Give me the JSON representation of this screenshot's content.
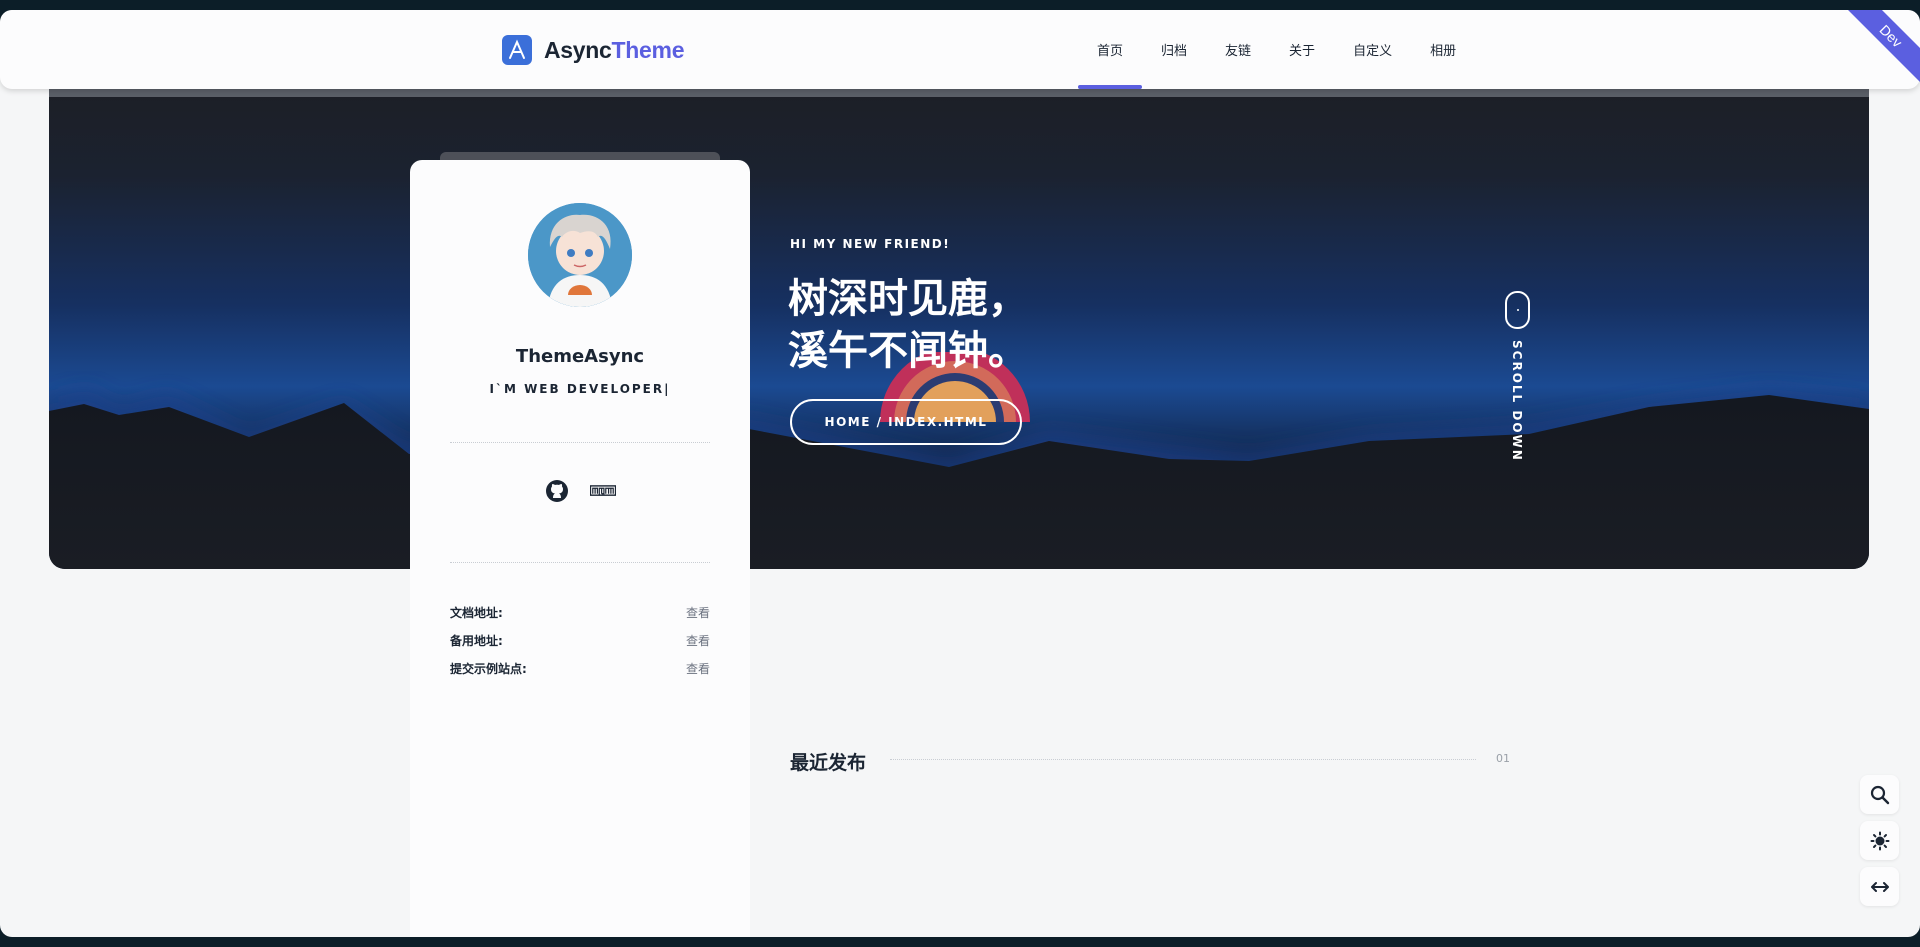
{
  "header": {
    "logo_text_a": "Async",
    "logo_text_b": "Theme",
    "nav": [
      "首页",
      "归档",
      "友链",
      "关于",
      "自定义",
      "相册"
    ],
    "active_index": 0,
    "badge": "Dev"
  },
  "profile": {
    "name": "ThemeAsync",
    "subtitle": "I`M WEB DEVELOPER|",
    "links": [
      {
        "label": "文档地址:",
        "action": "查看"
      },
      {
        "label": "备用地址:",
        "action": "查看"
      },
      {
        "label": "提交示例站点:",
        "action": "查看"
      }
    ]
  },
  "hero": {
    "kicker": "HI MY NEW FRIEND!",
    "title_line1": "树深时见鹿，",
    "title_line2": "溪午不闻钟。",
    "button": "HOME / INDEX.HTML",
    "scroll": "SCROLL DOWN"
  },
  "recent": {
    "title": "最近发布",
    "number": "01"
  },
  "colors": {
    "accent": "#5b5fe0",
    "text": "#1b2533",
    "hero_blue": "#1b4a92"
  }
}
